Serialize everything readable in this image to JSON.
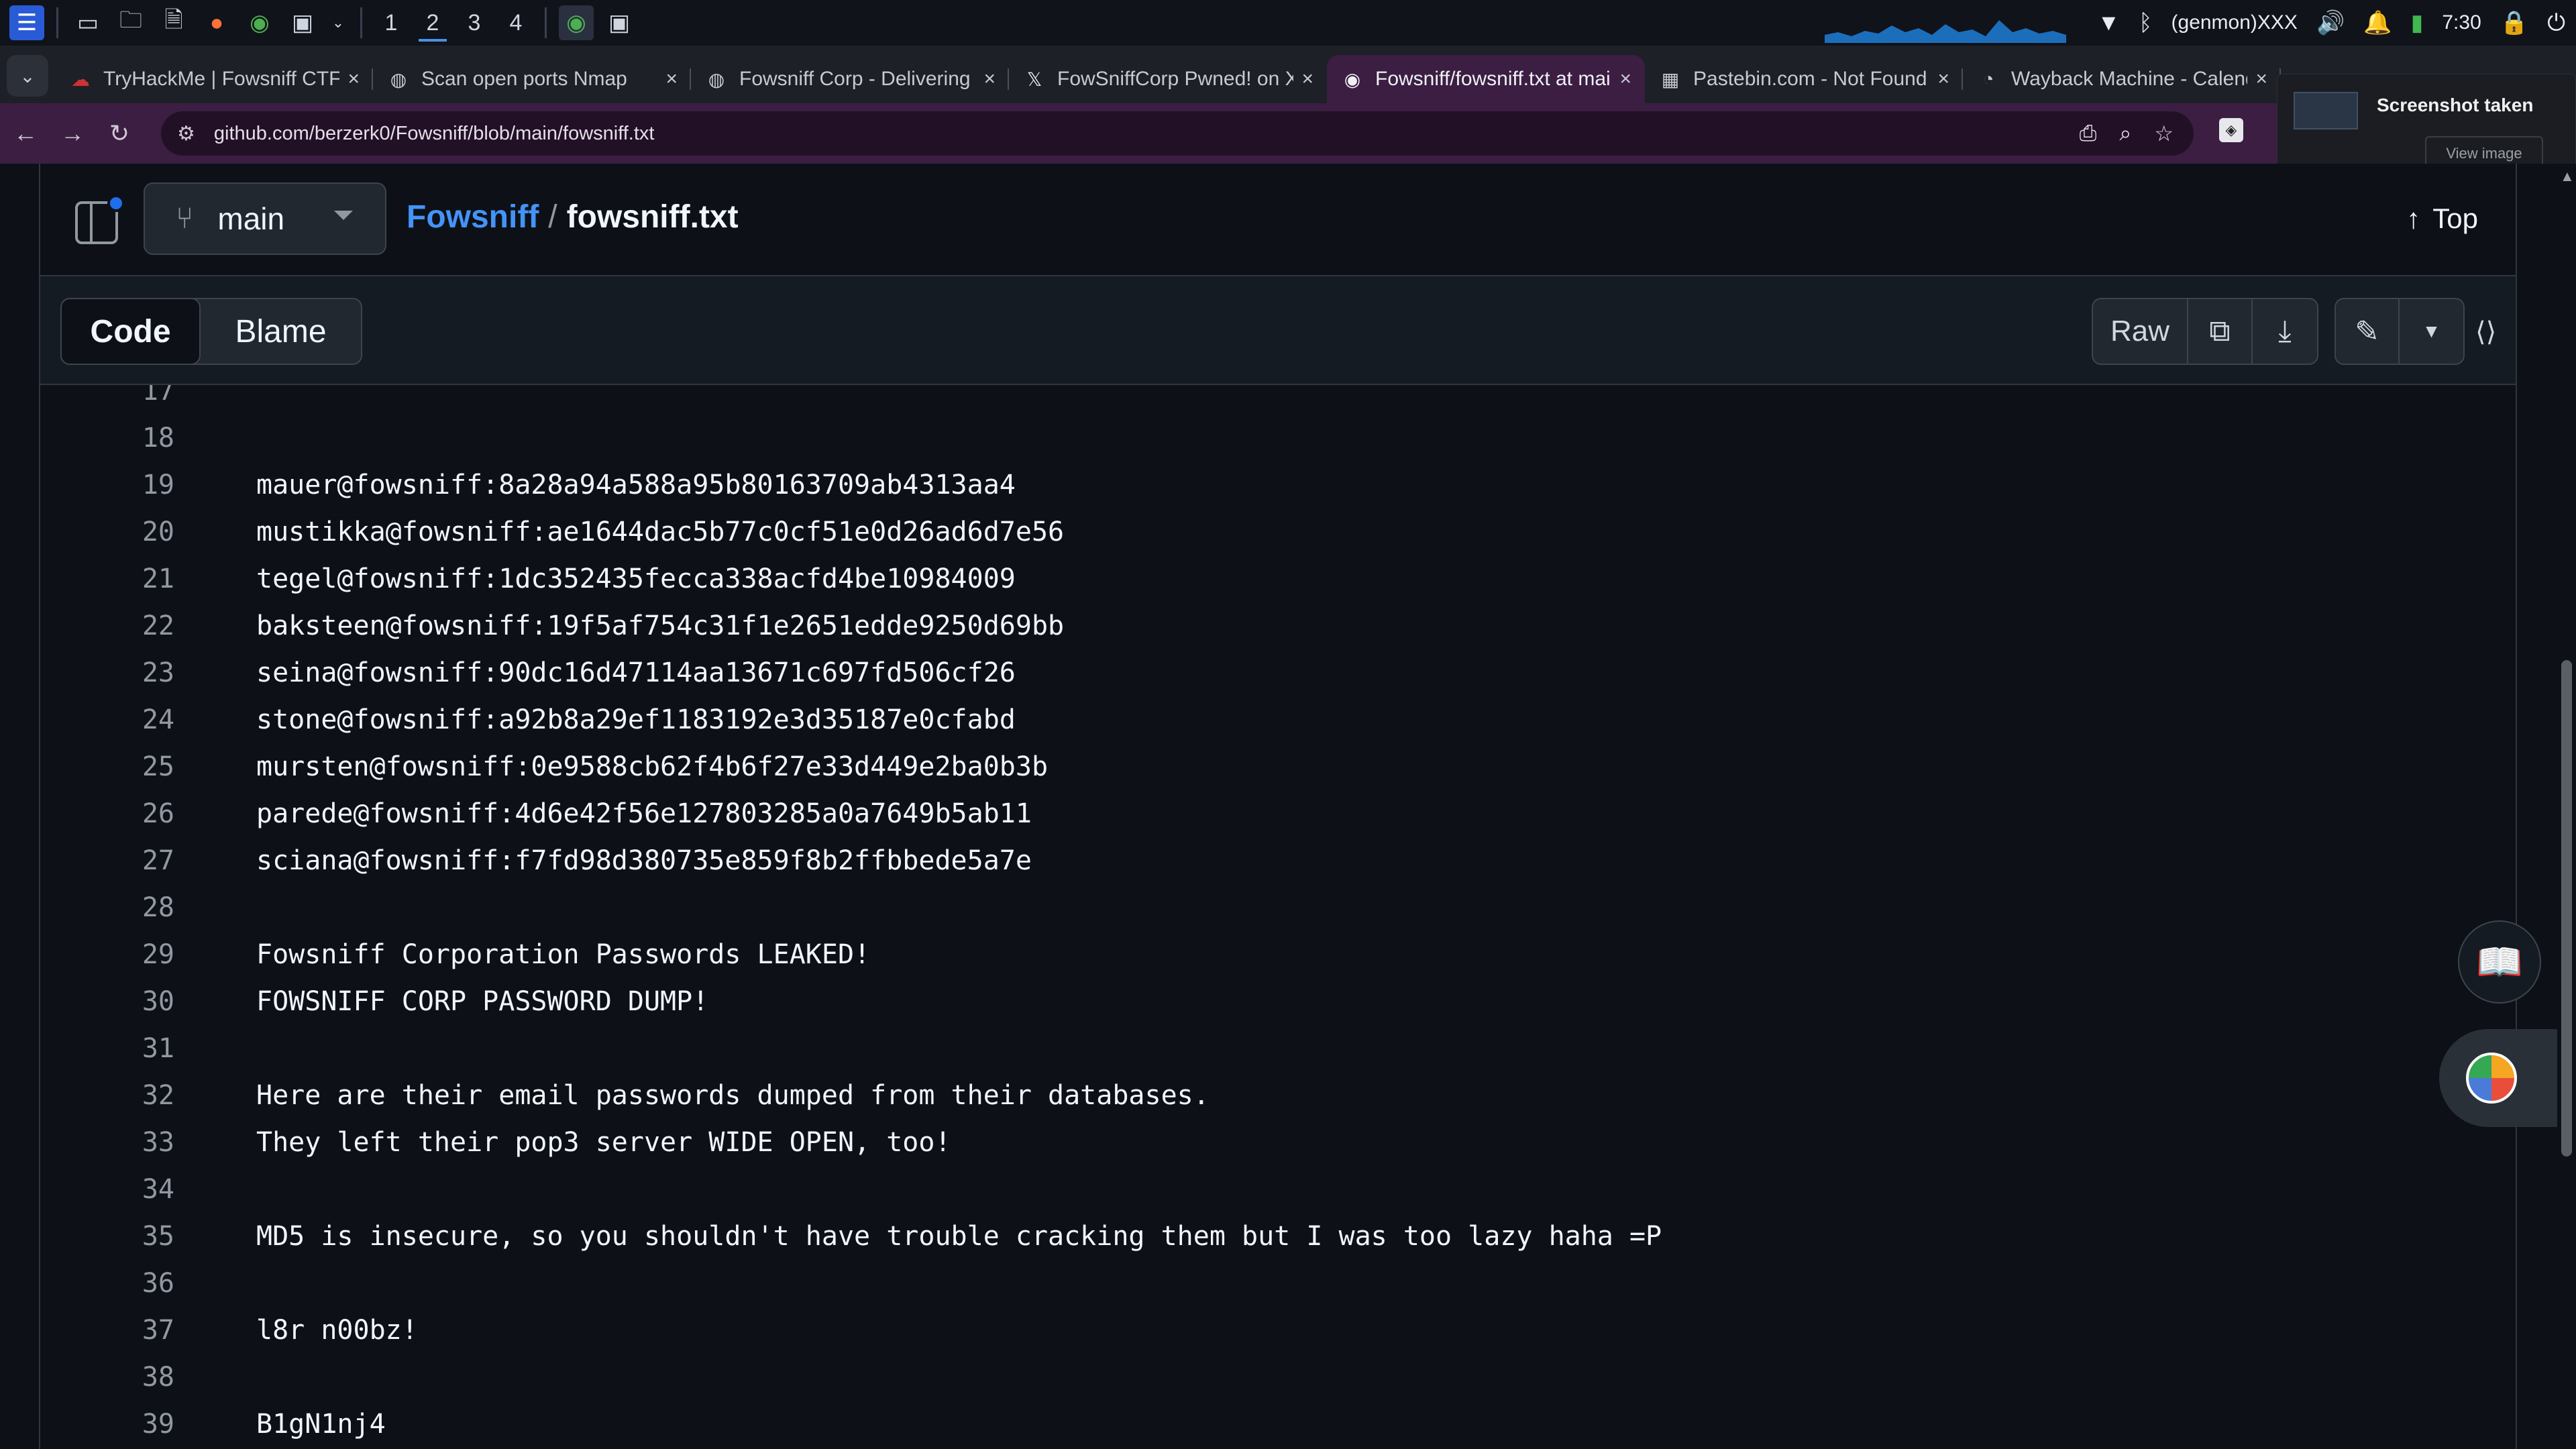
{
  "taskbar": {
    "workspaces": [
      "1",
      "2",
      "3",
      "4"
    ],
    "active_workspace": "2",
    "genmon": "(genmon)XXX",
    "clock": "7:30"
  },
  "tabs": [
    {
      "title": "TryHackMe | Fowsniff CTF",
      "icon": "tryhackme-icon"
    },
    {
      "title": "Scan open ports Nmap",
      "icon": "web-icon"
    },
    {
      "title": "Fowsniff Corp - Delivering",
      "icon": "web-icon"
    },
    {
      "title": "FowSniffCorp Pwned! on X",
      "icon": "x-icon"
    },
    {
      "title": "Fowsniff/fowsniff.txt at main",
      "icon": "github-icon"
    },
    {
      "title": "Pastebin.com - Not Found",
      "icon": "pastebin-icon"
    },
    {
      "title": "Wayback Machine - Calendar",
      "icon": "wayback-icon"
    }
  ],
  "active_tab": 4,
  "address": {
    "url": "github.com/berzerk0/Fowsniff/blob/main/fowsniff.txt"
  },
  "notification": {
    "title": "Screenshot taken",
    "button": "View image"
  },
  "file_header": {
    "branch": "main",
    "repo": "Fowsniff",
    "separator": "/",
    "file": "fowsniff.txt",
    "top_label": "Top"
  },
  "file_toolbar": {
    "code_tab": "Code",
    "blame_tab": "Blame",
    "raw_button": "Raw"
  },
  "code_lines": [
    {
      "n": "17",
      "text": ""
    },
    {
      "n": "18",
      "text": ""
    },
    {
      "n": "19",
      "text": "mauer@fowsniff:8a28a94a588a95b80163709ab4313aa4"
    },
    {
      "n": "20",
      "text": "mustikka@fowsniff:ae1644dac5b77c0cf51e0d26ad6d7e56"
    },
    {
      "n": "21",
      "text": "tegel@fowsniff:1dc352435fecca338acfd4be10984009"
    },
    {
      "n": "22",
      "text": "baksteen@fowsniff:19f5af754c31f1e2651edde9250d69bb"
    },
    {
      "n": "23",
      "text": "seina@fowsniff:90dc16d47114aa13671c697fd506cf26"
    },
    {
      "n": "24",
      "text": "stone@fowsniff:a92b8a29ef1183192e3d35187e0cfabd"
    },
    {
      "n": "25",
      "text": "mursten@fowsniff:0e9588cb62f4b6f27e33d449e2ba0b3b"
    },
    {
      "n": "26",
      "text": "parede@fowsniff:4d6e42f56e127803285a0a7649b5ab11"
    },
    {
      "n": "27",
      "text": "sciana@fowsniff:f7fd98d380735e859f8b2ffbbede5a7e"
    },
    {
      "n": "28",
      "text": ""
    },
    {
      "n": "29",
      "text": "Fowsniff Corporation Passwords LEAKED!"
    },
    {
      "n": "30",
      "text": "FOWSNIFF CORP PASSWORD DUMP!"
    },
    {
      "n": "31",
      "text": ""
    },
    {
      "n": "32",
      "text": "Here are their email passwords dumped from their databases."
    },
    {
      "n": "33",
      "text": "They left their pop3 server WIDE OPEN, too!"
    },
    {
      "n": "34",
      "text": ""
    },
    {
      "n": "35",
      "text": "MD5 is insecure, so you shouldn't have trouble cracking them but I was too lazy haha =P"
    },
    {
      "n": "36",
      "text": ""
    },
    {
      "n": "37",
      "text": "l8r n00bz!"
    },
    {
      "n": "38",
      "text": ""
    },
    {
      "n": "39",
      "text": "B1gN1nj4"
    }
  ]
}
